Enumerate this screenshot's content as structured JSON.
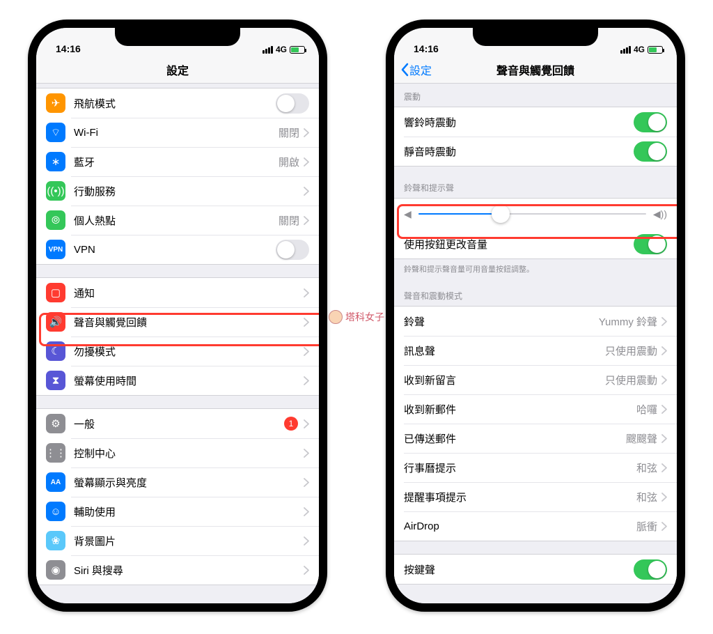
{
  "status": {
    "time": "14:16",
    "network": "4G"
  },
  "watermark": "塔科女子",
  "phone1": {
    "title": "設定",
    "group1": [
      {
        "icon": "airplane-icon",
        "color": "c-orange",
        "label": "飛航模式",
        "type": "toggle",
        "on": false
      },
      {
        "icon": "wifi-icon",
        "color": "c-blue",
        "label": "Wi-Fi",
        "type": "link",
        "value": "關閉"
      },
      {
        "icon": "bluetooth-icon",
        "color": "c-blue",
        "label": "藍牙",
        "type": "link",
        "value": "開啟"
      },
      {
        "icon": "cellular-icon",
        "color": "c-green",
        "label": "行動服務",
        "type": "link",
        "value": ""
      },
      {
        "icon": "hotspot-icon",
        "color": "c-green",
        "label": "個人熱點",
        "type": "link",
        "value": "關閉"
      },
      {
        "icon": "vpn-icon",
        "color": "c-blue",
        "label": "VPN",
        "type": "toggle",
        "on": false
      }
    ],
    "group2": [
      {
        "icon": "notification-icon",
        "color": "c-red",
        "label": "通知",
        "type": "link",
        "value": ""
      },
      {
        "icon": "sound-icon",
        "color": "c-red",
        "label": "聲音與觸覺回饋",
        "type": "link",
        "value": "",
        "highlight": true
      },
      {
        "icon": "moon-icon",
        "color": "c-purple",
        "label": "勿擾模式",
        "type": "link",
        "value": ""
      },
      {
        "icon": "hourglass-icon",
        "color": "c-purple",
        "label": "螢幕使用時間",
        "type": "link",
        "value": ""
      }
    ],
    "group3": [
      {
        "icon": "gear-icon",
        "color": "c-gray",
        "label": "一般",
        "type": "link",
        "value": "",
        "badge": "1"
      },
      {
        "icon": "switches-icon",
        "color": "c-gray",
        "label": "控制中心",
        "type": "link",
        "value": ""
      },
      {
        "icon": "textsize-icon",
        "color": "c-blue",
        "label": "螢幕顯示與亮度",
        "type": "link",
        "value": ""
      },
      {
        "icon": "accessibility-icon",
        "color": "c-blue",
        "label": "輔助使用",
        "type": "link",
        "value": ""
      },
      {
        "icon": "wallpaper-icon",
        "color": "c-lblue",
        "label": "背景圖片",
        "type": "link",
        "value": ""
      },
      {
        "icon": "siri-icon",
        "color": "c-gray",
        "label": "Siri 與搜尋",
        "type": "link",
        "value": ""
      }
    ]
  },
  "phone2": {
    "back": "設定",
    "title": "聲音與觸覺回饋",
    "vibrate_header": "震動",
    "vibrate": [
      {
        "label": "響鈴時震動",
        "on": true
      },
      {
        "label": "靜音時震動",
        "on": true
      }
    ],
    "ringer_header": "鈴聲和提示聲",
    "slider_percent": 36,
    "change_with_buttons": {
      "label": "使用按鈕更改音量",
      "on": true
    },
    "ringer_footer": "鈴聲和提示聲音量可用音量按鈕調整。",
    "sounds_header": "聲音和震動模式",
    "sounds": [
      {
        "label": "鈴聲",
        "value": "Yummy 鈴聲"
      },
      {
        "label": "訊息聲",
        "value": "只使用震動"
      },
      {
        "label": "收到新留言",
        "value": "只使用震動"
      },
      {
        "label": "收到新郵件",
        "value": "哈囉"
      },
      {
        "label": "已傳送郵件",
        "value": "颼颼聲"
      },
      {
        "label": "行事曆提示",
        "value": "和弦"
      },
      {
        "label": "提醒事項提示",
        "value": "和弦"
      },
      {
        "label": "AirDrop",
        "value": "脈衝"
      }
    ],
    "keyboard": [
      {
        "label": "按鍵聲",
        "on": true
      }
    ]
  }
}
